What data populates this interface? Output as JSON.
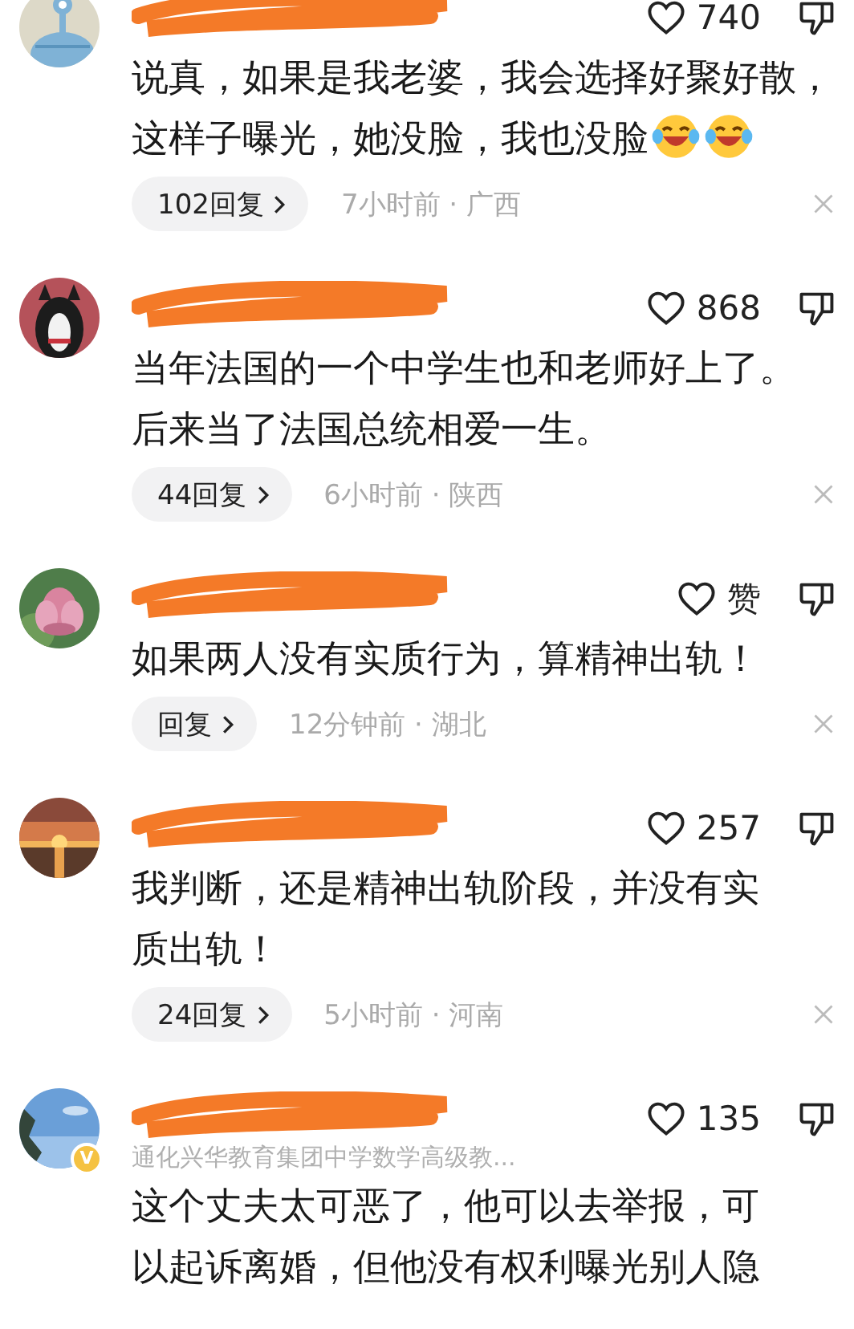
{
  "comments": [
    {
      "author_redacted": true,
      "verified": false,
      "likes": "740",
      "lines": [
        "说真，如果是我老婆，我会选择好聚好散，",
        "这样子曝光，她没脸，我也没脸"
      ],
      "emojis": [
        {
          "kind": "laugh-cry"
        },
        {
          "kind": "laugh-cry"
        }
      ],
      "replies": "102回复",
      "time": "7小时前 · 广西"
    },
    {
      "author_redacted": true,
      "verified": false,
      "likes": "868",
      "lines": [
        "当年法国的一个中学生也和老师好上了。",
        "后来当了法国总统相爱一生。"
      ],
      "replies": "44回复",
      "time": "6小时前 · 陕西"
    },
    {
      "author_redacted": true,
      "verified": false,
      "likes": "赞",
      "lines": [
        "如果两人没有实质行为，算精神出轨！"
      ],
      "replies": "回复",
      "time": "12分钟前 · 湖北"
    },
    {
      "author_redacted": true,
      "verified": false,
      "likes": "257",
      "lines": [
        "我判断，还是精神出轨阶段，并没有实",
        "质出轨！"
      ],
      "replies": "24回复",
      "time": "5小时前 · 河南"
    },
    {
      "author_redacted": true,
      "verified": true,
      "badge": "V",
      "subtitle": "通化兴华教育集团中学数学高级教...",
      "likes": "135",
      "lines": [
        "这个丈夫太可恶了，他可以去举报，可",
        "以起诉离婚，但他没有权利曝光别人隐"
      ]
    }
  ]
}
